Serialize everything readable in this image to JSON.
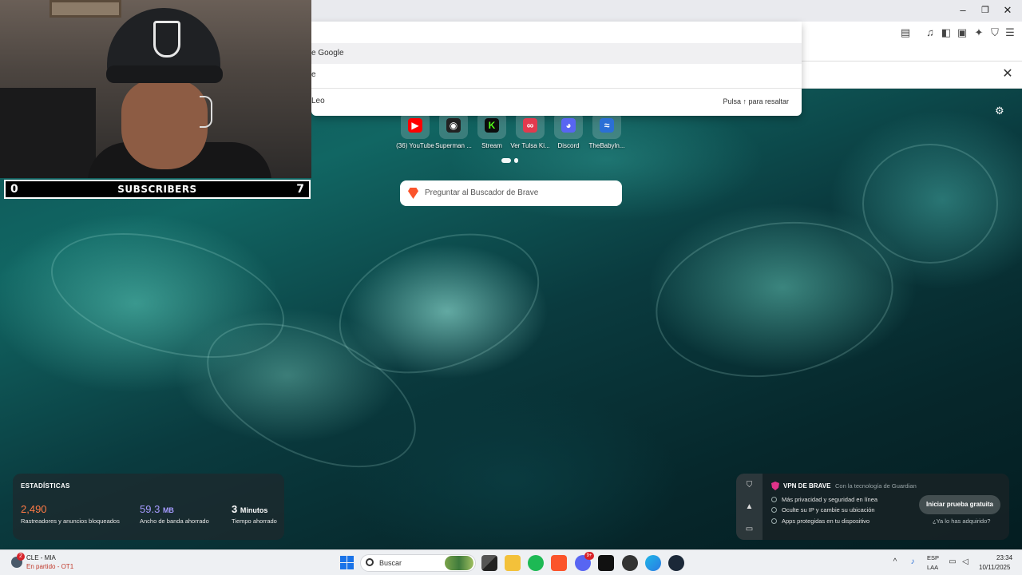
{
  "omnibox": {
    "rows": [
      "e Google",
      "e",
      "Leo"
    ],
    "hint": "Pulsa ↑ para resaltar"
  },
  "top_sites": [
    {
      "label": "(36) YouTube",
      "color": "#ff0000",
      "glyph": "▶"
    },
    {
      "label": "Superman ...",
      "color": "#222222",
      "glyph": "◉"
    },
    {
      "label": "Stream",
      "color": "#53fc18",
      "glyph": "K"
    },
    {
      "label": "Ver Tulsa Ki...",
      "color": "#e23a4e",
      "glyph": "∞"
    },
    {
      "label": "Discord",
      "color": "#5865f2",
      "glyph": "◕"
    },
    {
      "label": "TheBabyln...",
      "color": "#2b6fd6",
      "glyph": "≈"
    }
  ],
  "search": {
    "placeholder": "Preguntar al Buscador de Brave"
  },
  "webcam": {
    "subs_left": "0",
    "subs_label": "SUBSCRIBERS",
    "subs_right": "7"
  },
  "stats": {
    "title": "ESTADÍSTICAS",
    "trackers_value": "2,490",
    "trackers_label": "Rastreadores y anuncios bloqueados",
    "trackers_color": "#ff7a45",
    "bandwidth_value": "59.3",
    "bandwidth_unit": "MB",
    "bandwidth_label": "Ancho de banda ahorrado",
    "bandwidth_color": "#a59bff",
    "time_value": "3",
    "time_unit": "Minutos",
    "time_label": "Tiempo ahorrado"
  },
  "vpn": {
    "title": "VPN DE BRAVE",
    "by": "Con la tecnología de Guardian",
    "features": [
      "Más privacidad y seguridad en línea",
      "Oculte su IP y cambie su ubicación",
      "Apps protegidas en tu dispositivo"
    ],
    "button": "Iniciar prueba gratuita",
    "link": "¿Ya lo has adquirido?"
  },
  "taskbar": {
    "weather_badge": "2",
    "weather_line1": "CLE - MIA",
    "weather_line2": "En partido - OT1",
    "search_label": "Buscar",
    "lang1": "ESP",
    "lang2": "LAA",
    "time": "23:34",
    "date": "10/11/2025",
    "discord_badge": "9+"
  },
  "icons": {
    "minimize": "minimize-icon",
    "maximize": "maximize-icon",
    "close": "close-icon",
    "settings": "gear-icon"
  }
}
